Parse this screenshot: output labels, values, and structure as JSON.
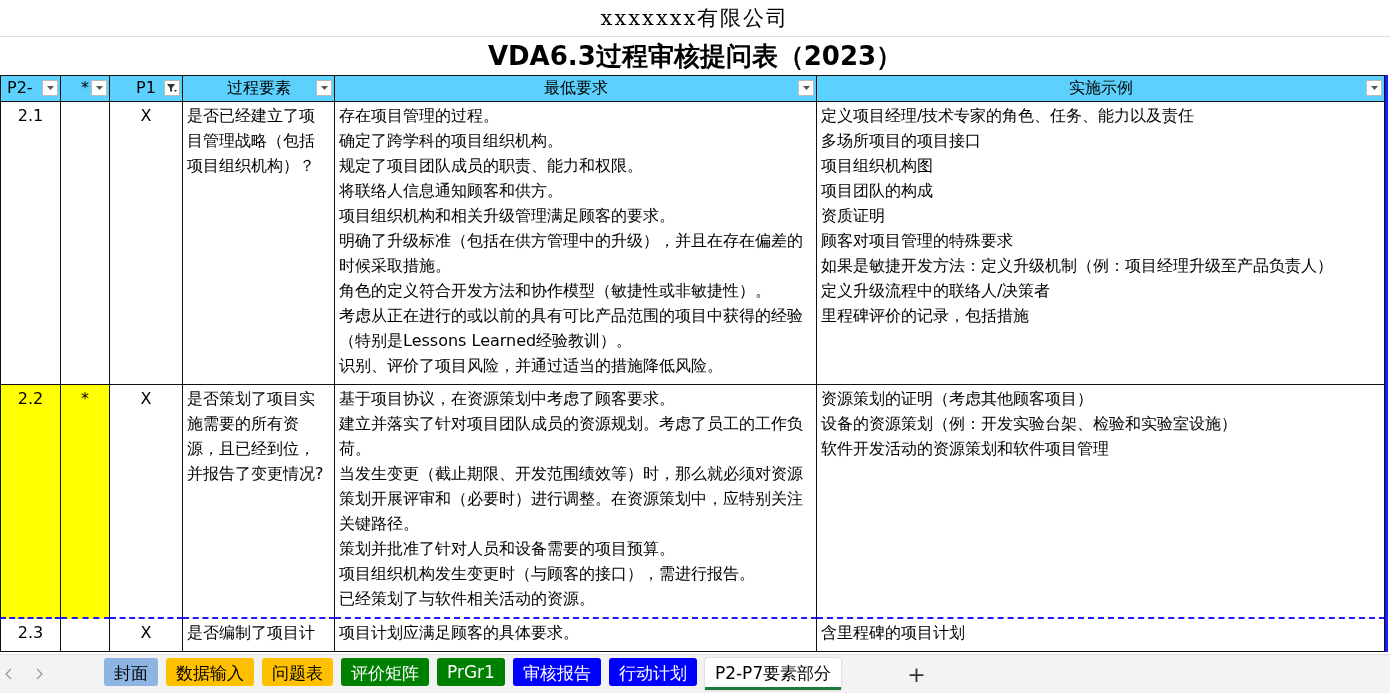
{
  "company": "xxxxxxx有限公司",
  "title": "VDA6.3过程审核提问表（2023）",
  "columns": [
    {
      "label": "P2-",
      "filtered": false
    },
    {
      "label": "*",
      "filtered": false
    },
    {
      "label": "P1",
      "filtered": true
    },
    {
      "label": "过程要素",
      "filtered": false
    },
    {
      "label": "最低要求",
      "filtered": false
    },
    {
      "label": "实施示例",
      "filtered": false
    }
  ],
  "rows": [
    {
      "id": "2.1",
      "star": "",
      "p1": "X",
      "highlighted": false,
      "question": "是否已经建立了项目管理战略（包括项目组织机构）？",
      "requirements": [
        "存在项目管理的过程。",
        "确定了跨学科的项目组织机构。",
        "规定了项目团队成员的职责、能力和权限。",
        "将联络人信息通知顾客和供方。",
        "项目组织机构和相关升级管理满足顾客的要求。",
        "明确了升级标准（包括在供方管理中的升级），并且在存在偏差的时候采取措施。",
        "角色的定义符合开发方法和协作模型（敏捷性或非敏捷性）。",
        "考虑从正在进行的或以前的具有可比产品范围的项目中获得的经验（特别是Lessons Learned经验教训）。",
        "识别、评价了项目风险，并通过适当的措施降低风险。"
      ],
      "examples": [
        "定义项目经理/技术专家的角色、任务、能力以及责任",
        "多场所项目的项目接口",
        "项目组织机构图",
        "项目团队的构成",
        "资质证明",
        "顾客对项目管理的特殊要求",
        "如果是敏捷开发方法：定义升级机制（例：项目经理升级至产品负责人）",
        "定义升级流程中的联络人/决策者",
        "里程碑评价的记录，包括措施"
      ]
    },
    {
      "id": "2.2",
      "star": "*",
      "p1": "X",
      "highlighted": true,
      "question": "是否策划了项目实施需要的所有资源，且已经到位，并报告了变更情况?",
      "requirements": [
        "基于项目协议，在资源策划中考虑了顾客要求。",
        "建立并落实了针对项目团队成员的资源规划。考虑了员工的工作负荷。",
        "当发生变更（截止期限、开发范围绩效等）时，那么就必须对资源策划开展评审和（必要时）进行调整。在资源策划中，应特别关注关键路径。",
        "策划并批准了针对人员和设备需要的项目预算。",
        "项目组织机构发生变更时（与顾客的接口），需进行报告。",
        "已经策划了与软件相关活动的资源。"
      ],
      "examples": [
        "资源策划的证明（考虑其他顾客项目）",
        "设备的资源策划（例：开发实验台架、检验和实验室设施）",
        "软件开发活动的资源策划和软件项目管理"
      ]
    },
    {
      "id": "2.3",
      "star": "",
      "p1": "X",
      "highlighted": false,
      "question": "是否编制了项目计",
      "requirements": [
        "项目计划应满足顾客的具体要求。"
      ],
      "examples": [
        "含里程碑的项目计划"
      ]
    }
  ],
  "sheet_tabs": [
    {
      "label": "封面",
      "color": "#8db4e2",
      "selected": false
    },
    {
      "label": "数据输入",
      "color": "#ffc000",
      "selected": false
    },
    {
      "label": "问题表",
      "color": "#ffc000",
      "selected": false
    },
    {
      "label": "评价矩阵",
      "color": "#008000",
      "selected": false
    },
    {
      "label": "PrGr1",
      "color": "#008000",
      "selected": false
    },
    {
      "label": "审核报告",
      "color": "#0000ff",
      "selected": false
    },
    {
      "label": "行动计划",
      "color": "#0000ff",
      "selected": false
    },
    {
      "label": "P2-P7要素部分",
      "color": "#ffffff",
      "selected": true
    }
  ],
  "add_sheet": "+"
}
